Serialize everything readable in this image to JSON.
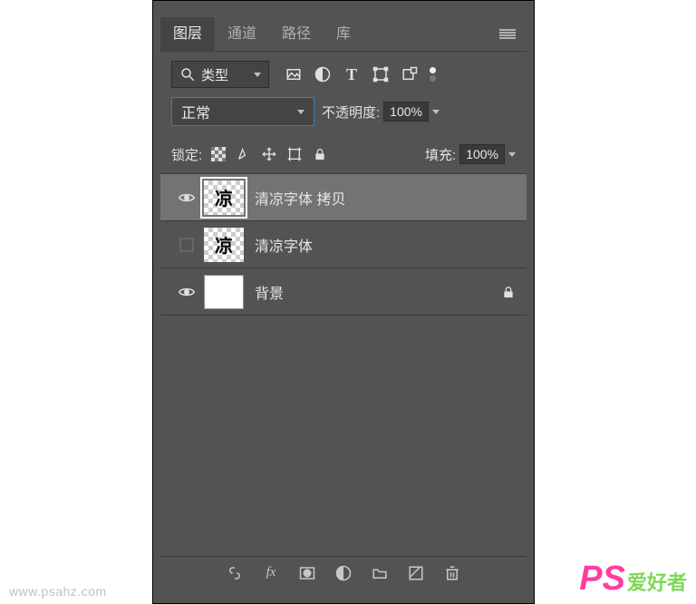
{
  "tabs": {
    "layers": "图层",
    "channels": "通道",
    "paths": "路径",
    "library": "库"
  },
  "filter": {
    "label": "类型"
  },
  "blend": {
    "mode": "正常",
    "opacity_label": "不透明度:",
    "opacity_value": "100%"
  },
  "lock": {
    "label": "锁定:",
    "fill_label": "填充:",
    "fill_value": "100%"
  },
  "layers": [
    {
      "name": "清凉字体 拷贝",
      "visible": true,
      "selected": true,
      "thumb": "checker"
    },
    {
      "name": "清凉字体",
      "visible": false,
      "selected": false,
      "thumb": "checker"
    },
    {
      "name": "背景",
      "visible": true,
      "selected": false,
      "thumb": "white",
      "locked": true
    }
  ],
  "watermark": {
    "url": "www.psahz.com",
    "logo_ps": "PS",
    "logo_cn": "爱好者"
  }
}
